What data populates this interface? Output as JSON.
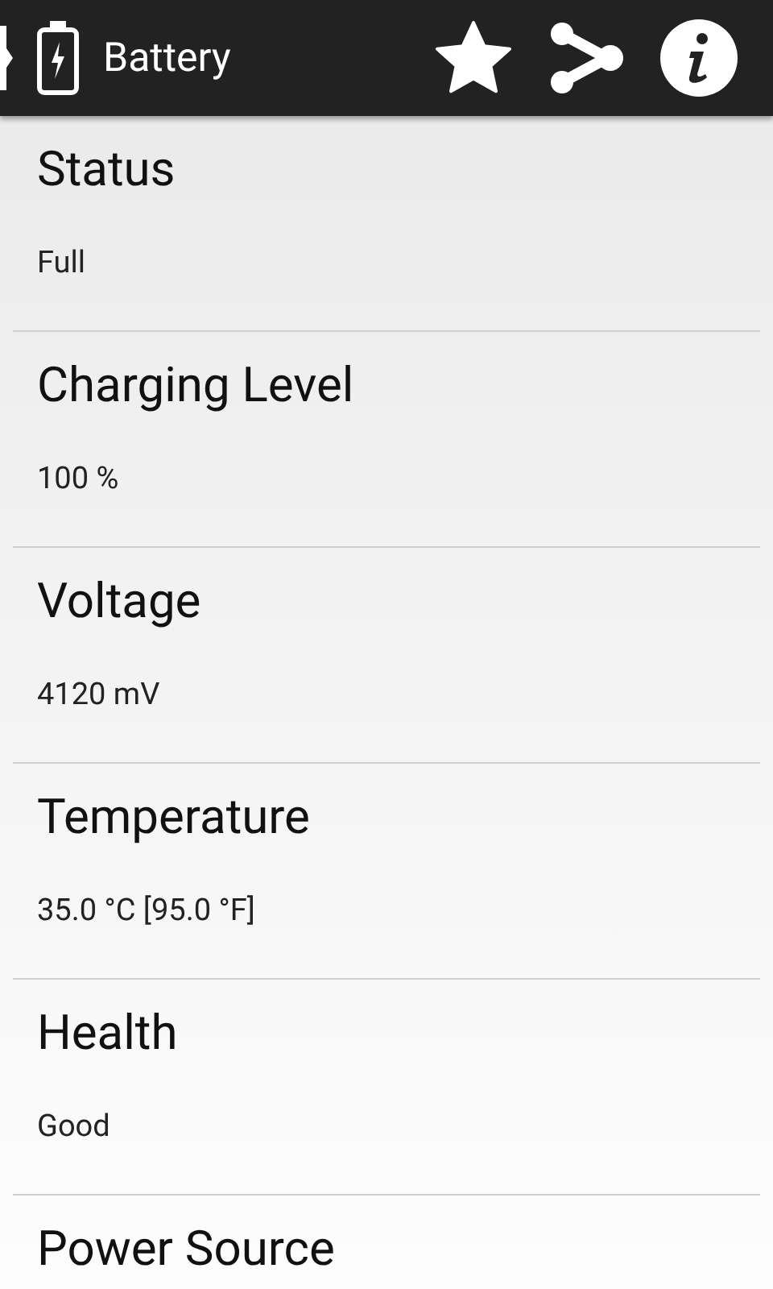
{
  "app_bar": {
    "title": "Battery"
  },
  "items": [
    {
      "label": "Status",
      "value": "Full"
    },
    {
      "label": "Charging Level",
      "value": "100 %"
    },
    {
      "label": "Voltage",
      "value": "4120 mV"
    },
    {
      "label": "Temperature",
      "value": "35.0 °C [95.0 °F]"
    },
    {
      "label": "Health",
      "value": "Good"
    },
    {
      "label": "Power Source"
    }
  ]
}
